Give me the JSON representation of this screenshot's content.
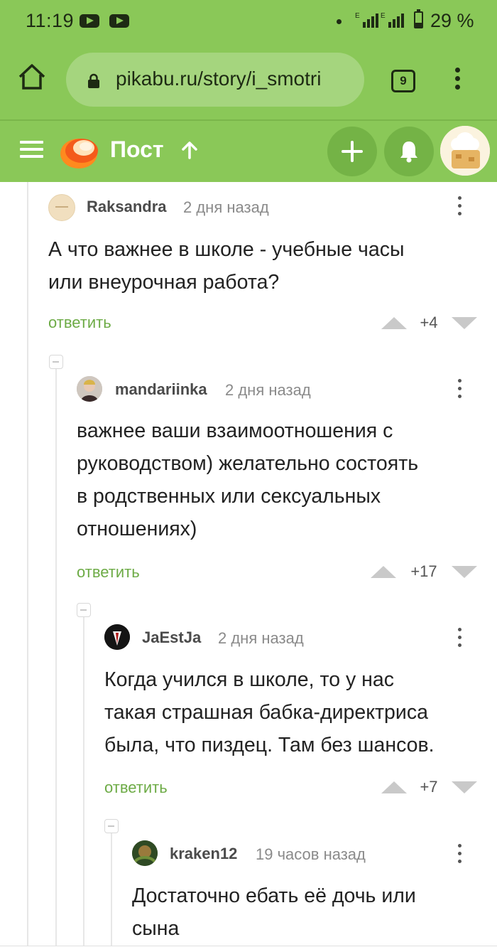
{
  "status_bar": {
    "time": "11:19",
    "battery": "29 %",
    "network_label_1": "E",
    "network_label_2": "E"
  },
  "browser": {
    "url": "pikabu.ru/story/i_smotri",
    "tab_count": "9"
  },
  "app_header": {
    "title": "Пост"
  },
  "comments": [
    {
      "author": "Raksandra",
      "time": "2 дня назад",
      "text_lines": [
        "А что важнее в школе - учебные часы",
        "или внеурочная работа?"
      ],
      "reply_label": "ответить",
      "score": "+4"
    },
    {
      "author": "mandariinka",
      "time": "2 дня назад",
      "text_lines": [
        "важнее ваши взаимоотношения с",
        "руководством) желательно состоять",
        "в родственных или сексуальных",
        "отношениях)"
      ],
      "reply_label": "ответить",
      "score": "+17"
    },
    {
      "author": "JaEstJa",
      "time": "2 дня назад",
      "text_lines": [
        "Когда учился в школе, то у нас",
        "такая страшная бабка-директриса",
        "была, что пиздец. Там без шансов."
      ],
      "reply_label": "ответить",
      "score": "+7"
    },
    {
      "author": "kraken12",
      "time": "19 часов назад",
      "text_lines": [
        "Достаточно ебать её дочь или",
        "сына"
      ]
    }
  ],
  "colors": {
    "brand_green": "#8ac858",
    "reply_green": "#6dab46"
  }
}
